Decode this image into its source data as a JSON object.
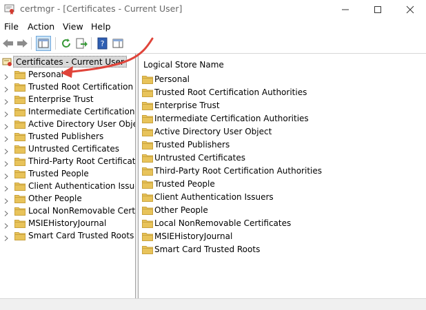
{
  "window": {
    "title": "certmgr - [Certificates - Current User]"
  },
  "menu": [
    "File",
    "Action",
    "View",
    "Help"
  ],
  "tree": {
    "root": "Certificates - Current User",
    "items": [
      "Personal",
      "Trusted Root Certification Au",
      "Enterprise Trust",
      "Intermediate Certification Au",
      "Active Directory User Object",
      "Trusted Publishers",
      "Untrusted Certificates",
      "Third-Party Root Certification",
      "Trusted People",
      "Client Authentication Issuers",
      "Other People",
      "Local NonRemovable Certific",
      "MSIEHistoryJournal",
      "Smart Card Trusted Roots"
    ]
  },
  "list": {
    "column_header": "Logical Store Name",
    "items": [
      "Personal",
      "Trusted Root Certification Authorities",
      "Enterprise Trust",
      "Intermediate Certification Authorities",
      "Active Directory User Object",
      "Trusted Publishers",
      "Untrusted Certificates",
      "Third-Party Root Certification Authorities",
      "Trusted People",
      "Client Authentication Issuers",
      "Other People",
      "Local NonRemovable Certificates",
      "MSIEHistoryJournal",
      "Smart Card Trusted Roots"
    ]
  },
  "toolbar_icons": [
    "back-icon",
    "forward-icon",
    "show-hide-console-tree-icon",
    "refresh-icon",
    "export-list-icon",
    "help-icon",
    "show-hide-action-pane-icon"
  ],
  "colors": {
    "folder": "#e8c35a",
    "annotation_arrow": "#e0443a",
    "selection": "#d9d9d9"
  }
}
